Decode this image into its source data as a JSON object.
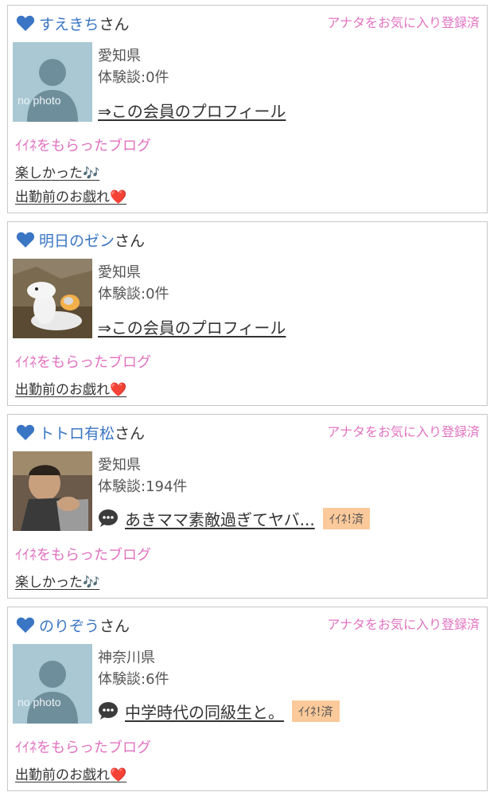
{
  "members": [
    {
      "name": "すえきち",
      "honorific": "さん",
      "favorite_status": "アナタをお気に入り登録済",
      "prefecture": "愛知県",
      "review_count": "体験談:0件",
      "profile_link": "⇒この会員のプロフィール",
      "photo_caption": "no photo",
      "blog_heading": "ｲｲﾈをもらったブログ",
      "blogs": [
        "楽しかった🎶",
        "出勤前のお戯れ❤️"
      ]
    },
    {
      "name": "明日のゼン",
      "honorific": "さん",
      "prefecture": "愛知県",
      "review_count": "体験談:0件",
      "profile_link": "⇒この会員のプロフィール",
      "blog_heading": "ｲｲﾈをもらったブログ",
      "blogs": [
        "出勤前のお戯れ❤️"
      ]
    },
    {
      "name": "トトロ有松",
      "honorific": "さん",
      "favorite_status": "アナタをお気に入り登録済",
      "prefecture": "愛知県",
      "review_count": "体験談:194件",
      "latest_review": "あきママ素敵過ぎてヤバ...",
      "iine_badge": "ｲｲﾈ!済",
      "blog_heading": "ｲｲﾈをもらったブログ",
      "blogs": [
        "楽しかった🎶"
      ]
    },
    {
      "name": "のりぞう",
      "honorific": "さん",
      "favorite_status": "アナタをお気に入り登録済",
      "prefecture": "神奈川県",
      "review_count": "体験談:6件",
      "latest_review": "中学時代の同級生と。",
      "iine_badge": "ｲｲﾈ!済",
      "photo_caption": "no photo",
      "blog_heading": "ｲｲﾈをもらったブログ",
      "blogs": [
        "出勤前のお戯れ❤️"
      ]
    }
  ],
  "colors": {
    "name": "#3a76c4",
    "pink": "#e072c0",
    "badge": "#fbc99a",
    "border": "#c8c8c8"
  }
}
